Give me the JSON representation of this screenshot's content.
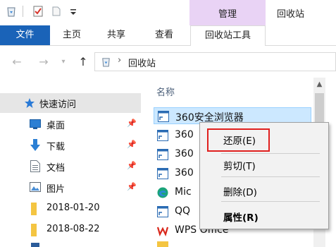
{
  "ribbon": {
    "contextual_group": "管理",
    "window_title": "回收站",
    "tabs": [
      "文件",
      "主页",
      "共享",
      "查看",
      "回收站工具"
    ]
  },
  "address": {
    "path": "回收站"
  },
  "nav_pane": {
    "items": [
      {
        "label": "快速访问",
        "icon": "star-icon"
      },
      {
        "label": "桌面",
        "icon": "desktop-icon",
        "pinned": true
      },
      {
        "label": "下载",
        "icon": "download-icon",
        "pinned": true
      },
      {
        "label": "文档",
        "icon": "document-icon",
        "pinned": true
      },
      {
        "label": "图片",
        "icon": "picture-icon",
        "pinned": true
      },
      {
        "label": "2018-01-20",
        "icon": "folder-icon"
      },
      {
        "label": "2018-08-22",
        "icon": "folder-icon"
      }
    ]
  },
  "file_list": {
    "column_name": "名称",
    "files": [
      {
        "name": "360安全浏览器",
        "icon": "shortcut-icon",
        "selected": true
      },
      {
        "name": "360",
        "icon": "shortcut-icon"
      },
      {
        "name": "360",
        "icon": "shortcut-icon"
      },
      {
        "name": "360",
        "icon": "shortcut-icon"
      },
      {
        "name": "Mic",
        "icon": "edge-icon"
      },
      {
        "name": "QQ",
        "icon": "shortcut-icon"
      },
      {
        "name": "WPS Office",
        "icon": "wps-icon"
      }
    ]
  },
  "context_menu": {
    "restore": "还原(E)",
    "cut": "剪切(T)",
    "delete": "删除(D)",
    "properties": "属性(R)"
  },
  "colors": {
    "file_tab": "#1a63b8",
    "contextual_tab": "#e9d3f5",
    "selection": "#cce8ff",
    "highlight_box": "#e0201e"
  }
}
